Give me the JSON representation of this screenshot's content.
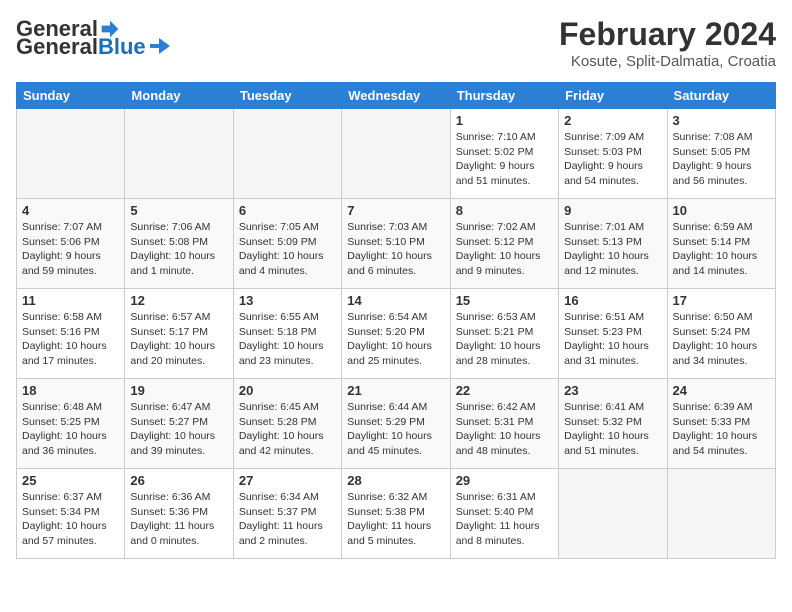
{
  "logo": {
    "general": "General",
    "blue": "Blue"
  },
  "title": "February 2024",
  "subtitle": "Kosute, Split-Dalmatia, Croatia",
  "days_of_week": [
    "Sunday",
    "Monday",
    "Tuesday",
    "Wednesday",
    "Thursday",
    "Friday",
    "Saturday"
  ],
  "weeks": [
    [
      {
        "day": "",
        "info": ""
      },
      {
        "day": "",
        "info": ""
      },
      {
        "day": "",
        "info": ""
      },
      {
        "day": "",
        "info": ""
      },
      {
        "day": "1",
        "info": "Sunrise: 7:10 AM\nSunset: 5:02 PM\nDaylight: 9 hours and 51 minutes."
      },
      {
        "day": "2",
        "info": "Sunrise: 7:09 AM\nSunset: 5:03 PM\nDaylight: 9 hours and 54 minutes."
      },
      {
        "day": "3",
        "info": "Sunrise: 7:08 AM\nSunset: 5:05 PM\nDaylight: 9 hours and 56 minutes."
      }
    ],
    [
      {
        "day": "4",
        "info": "Sunrise: 7:07 AM\nSunset: 5:06 PM\nDaylight: 9 hours and 59 minutes."
      },
      {
        "day": "5",
        "info": "Sunrise: 7:06 AM\nSunset: 5:08 PM\nDaylight: 10 hours and 1 minute."
      },
      {
        "day": "6",
        "info": "Sunrise: 7:05 AM\nSunset: 5:09 PM\nDaylight: 10 hours and 4 minutes."
      },
      {
        "day": "7",
        "info": "Sunrise: 7:03 AM\nSunset: 5:10 PM\nDaylight: 10 hours and 6 minutes."
      },
      {
        "day": "8",
        "info": "Sunrise: 7:02 AM\nSunset: 5:12 PM\nDaylight: 10 hours and 9 minutes."
      },
      {
        "day": "9",
        "info": "Sunrise: 7:01 AM\nSunset: 5:13 PM\nDaylight: 10 hours and 12 minutes."
      },
      {
        "day": "10",
        "info": "Sunrise: 6:59 AM\nSunset: 5:14 PM\nDaylight: 10 hours and 14 minutes."
      }
    ],
    [
      {
        "day": "11",
        "info": "Sunrise: 6:58 AM\nSunset: 5:16 PM\nDaylight: 10 hours and 17 minutes."
      },
      {
        "day": "12",
        "info": "Sunrise: 6:57 AM\nSunset: 5:17 PM\nDaylight: 10 hours and 20 minutes."
      },
      {
        "day": "13",
        "info": "Sunrise: 6:55 AM\nSunset: 5:18 PM\nDaylight: 10 hours and 23 minutes."
      },
      {
        "day": "14",
        "info": "Sunrise: 6:54 AM\nSunset: 5:20 PM\nDaylight: 10 hours and 25 minutes."
      },
      {
        "day": "15",
        "info": "Sunrise: 6:53 AM\nSunset: 5:21 PM\nDaylight: 10 hours and 28 minutes."
      },
      {
        "day": "16",
        "info": "Sunrise: 6:51 AM\nSunset: 5:23 PM\nDaylight: 10 hours and 31 minutes."
      },
      {
        "day": "17",
        "info": "Sunrise: 6:50 AM\nSunset: 5:24 PM\nDaylight: 10 hours and 34 minutes."
      }
    ],
    [
      {
        "day": "18",
        "info": "Sunrise: 6:48 AM\nSunset: 5:25 PM\nDaylight: 10 hours and 36 minutes."
      },
      {
        "day": "19",
        "info": "Sunrise: 6:47 AM\nSunset: 5:27 PM\nDaylight: 10 hours and 39 minutes."
      },
      {
        "day": "20",
        "info": "Sunrise: 6:45 AM\nSunset: 5:28 PM\nDaylight: 10 hours and 42 minutes."
      },
      {
        "day": "21",
        "info": "Sunrise: 6:44 AM\nSunset: 5:29 PM\nDaylight: 10 hours and 45 minutes."
      },
      {
        "day": "22",
        "info": "Sunrise: 6:42 AM\nSunset: 5:31 PM\nDaylight: 10 hours and 48 minutes."
      },
      {
        "day": "23",
        "info": "Sunrise: 6:41 AM\nSunset: 5:32 PM\nDaylight: 10 hours and 51 minutes."
      },
      {
        "day": "24",
        "info": "Sunrise: 6:39 AM\nSunset: 5:33 PM\nDaylight: 10 hours and 54 minutes."
      }
    ],
    [
      {
        "day": "25",
        "info": "Sunrise: 6:37 AM\nSunset: 5:34 PM\nDaylight: 10 hours and 57 minutes."
      },
      {
        "day": "26",
        "info": "Sunrise: 6:36 AM\nSunset: 5:36 PM\nDaylight: 11 hours and 0 minutes."
      },
      {
        "day": "27",
        "info": "Sunrise: 6:34 AM\nSunset: 5:37 PM\nDaylight: 11 hours and 2 minutes."
      },
      {
        "day": "28",
        "info": "Sunrise: 6:32 AM\nSunset: 5:38 PM\nDaylight: 11 hours and 5 minutes."
      },
      {
        "day": "29",
        "info": "Sunrise: 6:31 AM\nSunset: 5:40 PM\nDaylight: 11 hours and 8 minutes."
      },
      {
        "day": "",
        "info": ""
      },
      {
        "day": "",
        "info": ""
      }
    ]
  ]
}
